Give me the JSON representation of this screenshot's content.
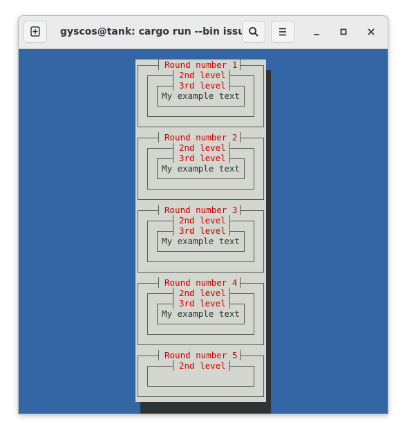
{
  "window": {
    "title": "gyscos@tank: cargo run --bin issue"
  },
  "colors": {
    "terminal_bg": "#3465a4",
    "panel_bg": "#d3d7cf",
    "label_red": "#cc0000",
    "shadow": "#2e3436"
  },
  "icons": {
    "new_tab": "new-tab-icon",
    "search": "search-icon",
    "menu": "hamburger-menu-icon",
    "minimize": "minimize-icon",
    "maximize": "maximize-icon",
    "close": "close-icon"
  },
  "rounds": [
    {
      "title": "Round number 1",
      "level2": "2nd level",
      "level3": "3rd level",
      "text": "My example text"
    },
    {
      "title": "Round number 2",
      "level2": "2nd level",
      "level3": "3rd level",
      "text": "My example text"
    },
    {
      "title": "Round number 3",
      "level2": "2nd level",
      "level3": "3rd level",
      "text": "My example text"
    },
    {
      "title": "Round number 4",
      "level2": "2nd level",
      "level3": "3rd level",
      "text": "My example text"
    },
    {
      "title": "Round number 5",
      "level2": "2nd level"
    }
  ]
}
